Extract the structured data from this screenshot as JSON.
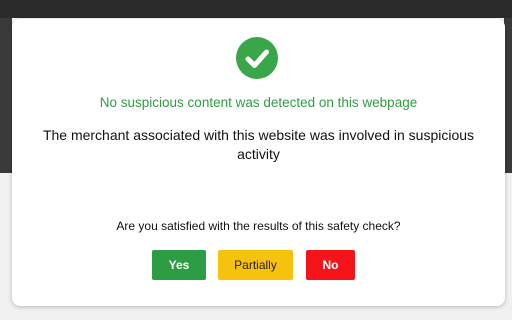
{
  "dialog": {
    "status_icon": "check-circle-icon",
    "status_text": "No suspicious content was detected on this webpage",
    "merchant_text": "The merchant associated with this website was involved in suspicious activity",
    "question_text": "Are you satisfied with the results of this safety check?",
    "buttons": {
      "yes_label": "Yes",
      "partially_label": "Partially",
      "no_label": "No"
    }
  },
  "colors": {
    "success": "#3aa64a",
    "yes": "#2d9d45",
    "partially": "#f6c20d",
    "no": "#f4141a"
  }
}
